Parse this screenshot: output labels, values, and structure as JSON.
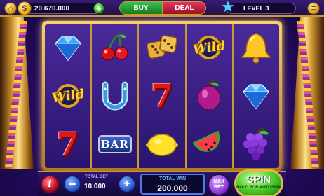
{
  "header": {
    "coin_symbol": "$",
    "coins": "20.670.000",
    "plus": "+",
    "buy_label": "BUY",
    "deal_label": "DEAL",
    "level_label": "LEVEL 3",
    "menu_icon": "≡"
  },
  "reels": [
    [
      "diamond",
      "wild",
      "seven"
    ],
    [
      "cherries",
      "horseshoe",
      "bar"
    ],
    [
      "dice",
      "seven",
      "lemon"
    ],
    [
      "wild",
      "plum",
      "watermelon"
    ],
    [
      "bell",
      "diamond",
      "grapes"
    ]
  ],
  "symbol_text": {
    "wild": "Wild",
    "bar": "BAR",
    "seven": "7"
  },
  "footer": {
    "info_label": "i",
    "minus_label": "−",
    "plus_label": "+",
    "total_bet_label": "TOTAL BET",
    "total_bet_value": "10.000",
    "total_win_label": "TOTAL WIN",
    "total_win_value": "200.000",
    "max_bet_label": "MAX BET",
    "spin_label": "SPIN",
    "spin_sub_label": "HOLD FOR AUTOSPIN"
  },
  "colors": {
    "accent_gold": "#c99a2e",
    "buy_green": "#3ac24a",
    "deal_red": "#e8365a",
    "spin_green": "#4ad02a"
  }
}
